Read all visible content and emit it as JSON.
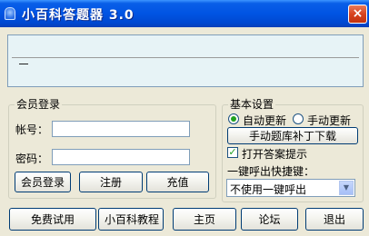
{
  "window": {
    "title": "小百科答题器 3.0",
    "close_label": "×"
  },
  "member": {
    "legend": "会员登录",
    "account_label": "帐号：",
    "account_value": "",
    "password_label": "密码：",
    "password_value": "",
    "login_button": "会员登录",
    "register_button": "注册",
    "recharge_button": "充值"
  },
  "settings": {
    "legend": "基本设置",
    "auto_update_label": "自动更新",
    "auto_update_selected": true,
    "manual_update_label": "手动更新",
    "manual_update_selected": false,
    "patch_download_button": "手动题库补丁下载",
    "show_answer_label": "打开答案提示",
    "show_answer_checked": true,
    "hotkey_label": "一键呼出快捷键：",
    "hotkey_value": "不使用一键呼出"
  },
  "bottom": {
    "free_trial_button": "免费试用",
    "tutorial_button": "小百科教程",
    "homepage_button": "主页",
    "forum_button": "论坛",
    "exit_button": "退出"
  }
}
